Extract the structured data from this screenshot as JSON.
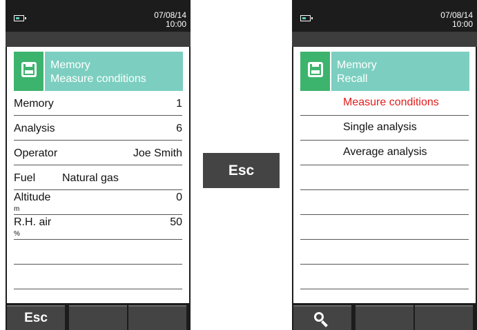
{
  "left_panel": {
    "status": {
      "date": "07/08/14",
      "time": "10:00"
    },
    "header": {
      "line1": "Memory",
      "line2": "Measure conditions"
    },
    "rows": [
      {
        "label": "Memory",
        "value": "1"
      },
      {
        "label": "Analysis",
        "value": "6"
      },
      {
        "label": "Operator",
        "value": "Joe Smith"
      },
      {
        "label": "Fuel",
        "value": "Natural gas"
      },
      {
        "label": "Altitude",
        "value": "0",
        "unit": "m"
      },
      {
        "label": "R.H. air",
        "value": "50",
        "unit": "%"
      }
    ],
    "fkeys": {
      "f1": "Esc"
    }
  },
  "center_key": {
    "label": "Esc"
  },
  "right_panel": {
    "status": {
      "date": "07/08/14",
      "time": "10:00"
    },
    "header": {
      "line1": "Memory",
      "line2": "Recall"
    },
    "menu": [
      {
        "label": "Measure conditions",
        "selected": true
      },
      {
        "label": "Single analysis"
      },
      {
        "label": "Average analysis"
      }
    ],
    "fkeys": {
      "f1_icon": "magnifier-icon"
    }
  },
  "colors": {
    "accent": "#7ccfc0",
    "icon_bg": "#3db46d",
    "selected": "#e11c1c",
    "device": "#1c1c1c"
  }
}
